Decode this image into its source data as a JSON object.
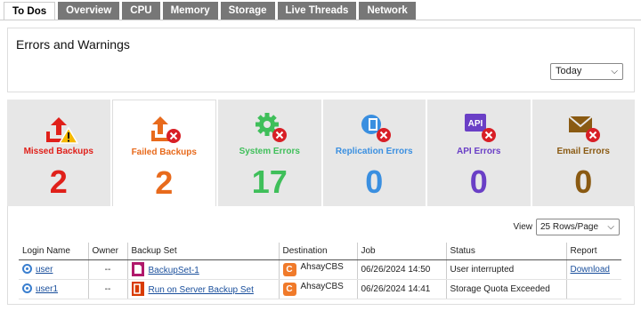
{
  "tabs": [
    {
      "label": "To Dos",
      "active": true
    },
    {
      "label": "Overview"
    },
    {
      "label": "CPU"
    },
    {
      "label": "Memory"
    },
    {
      "label": "Storage"
    },
    {
      "label": "Live Threads"
    },
    {
      "label": "Network"
    }
  ],
  "errors_panel": {
    "title": "Errors and Warnings",
    "period_select": "Today"
  },
  "cards": [
    {
      "label": "Missed Backups",
      "count": "2",
      "color": "#e0201a",
      "icon": "missed-backup-icon"
    },
    {
      "label": "Failed Backups",
      "count": "2",
      "color": "#e86a1c",
      "icon": "failed-backup-icon"
    },
    {
      "label": "System Errors",
      "count": "17",
      "color": "#3fbf5a",
      "icon": "system-error-gear-icon"
    },
    {
      "label": "Replication Errors",
      "count": "0",
      "color": "#3a8fe0",
      "icon": "replication-error-icon"
    },
    {
      "label": "API Errors",
      "count": "0",
      "color": "#6a3fc6",
      "icon": "api-error-icon"
    },
    {
      "label": "Email Errors",
      "count": "0",
      "color": "#8a5a12",
      "icon": "email-error-icon"
    }
  ],
  "table": {
    "view_label": "View",
    "rows_per_page": "25 Rows/Page",
    "columns": [
      "Login Name",
      "Owner",
      "Backup Set",
      "Destination",
      "Job",
      "Status",
      "Report"
    ],
    "rows": [
      {
        "login": "user",
        "owner": "--",
        "backup_set": "BackupSet-1",
        "destination": "AhsayCBS",
        "job": "06/26/2024 14:50",
        "status": "User interrupted",
        "report": "Download"
      },
      {
        "login": "user1",
        "owner": "--",
        "backup_set": "Run on Server Backup Set",
        "destination": "AhsayCBS",
        "job": "06/26/2024 14:41",
        "status": "Storage Quota Exceeded",
        "report": ""
      }
    ]
  }
}
